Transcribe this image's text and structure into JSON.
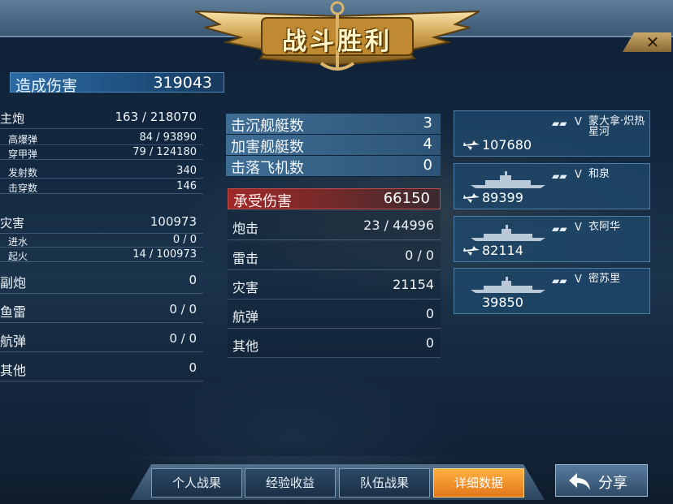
{
  "header": {
    "title": "战斗胜利",
    "close_glyph": "✕"
  },
  "left": {
    "damage_label": "造成伤害",
    "damage_value": "319043",
    "rows": [
      {
        "label": "主炮",
        "value": "163 / 218070",
        "style": "big"
      },
      {
        "label": "高爆弹",
        "value": "84 / 93890",
        "style": "sub"
      },
      {
        "label": "穿甲弹",
        "value": "79 / 124180",
        "style": "sub"
      },
      {
        "label": "发射数",
        "value": "340",
        "style": "sub"
      },
      {
        "label": "击穿数",
        "value": "146",
        "style": "sub"
      },
      {
        "label": "灾害",
        "value": "100973",
        "style": "big"
      },
      {
        "label": "进水",
        "value": "0 / 0",
        "style": "sub"
      },
      {
        "label": "起火",
        "value": "14 / 100973",
        "style": "sub"
      },
      {
        "label": "副炮",
        "value": "0",
        "style": "main"
      },
      {
        "label": "鱼雷",
        "value": "0 / 0",
        "style": "main"
      },
      {
        "label": "航弹",
        "value": "0 / 0",
        "style": "main"
      },
      {
        "label": "其他",
        "value": "0",
        "style": "main"
      }
    ]
  },
  "middle": {
    "stats": [
      {
        "label": "击沉舰艇数",
        "value": "3"
      },
      {
        "label": "加害舰艇数",
        "value": "4"
      },
      {
        "label": "击落飞机数",
        "value": "0"
      }
    ],
    "taken_label": "承受伤害",
    "taken_value": "66150",
    "rows": [
      {
        "label": "炮击",
        "value": "23 / 44996"
      },
      {
        "label": "雷击",
        "value": "0 / 0"
      },
      {
        "label": "灾害",
        "value": "21154"
      },
      {
        "label": "航弹",
        "value": "0"
      },
      {
        "label": "其他",
        "value": "0"
      }
    ]
  },
  "ships": [
    {
      "rank": "V",
      "name": "蒙大拿·炽热星河",
      "damage": "107680",
      "has_ship_image": false,
      "has_plane_icon": true
    },
    {
      "rank": "V",
      "name": "和泉",
      "damage": "89399",
      "has_ship_image": true,
      "has_plane_icon": true
    },
    {
      "rank": "V",
      "name": "衣阿华",
      "damage": "82114",
      "has_ship_image": true,
      "has_plane_icon": true
    },
    {
      "rank": "V",
      "name": "密苏里",
      "damage": "39850",
      "has_ship_image": true,
      "has_plane_icon": false
    }
  ],
  "tabs": [
    {
      "label": "个人战果",
      "active": false
    },
    {
      "label": "经验收益",
      "active": false
    },
    {
      "label": "队伍战果",
      "active": false
    },
    {
      "label": "详细数据",
      "active": true
    }
  ],
  "share_label": "分享",
  "icons": {
    "emblem": "anchor-wings-icon",
    "close": "close-icon",
    "ship": "battleship-icon",
    "plane": "plane-icon",
    "flag": "rank-stripes-icon",
    "share": "share-arrow-icon"
  },
  "colors": {
    "active_tab": "#e2761a",
    "damage_header": "#2b6aa3",
    "taken_header": "#a02828",
    "title_gold": "#fff3c8"
  }
}
